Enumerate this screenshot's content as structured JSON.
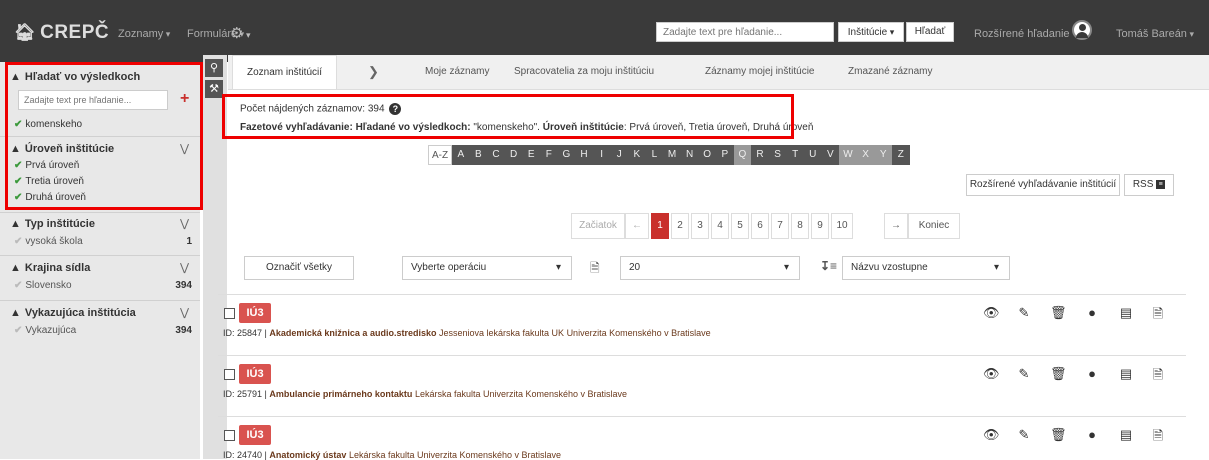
{
  "navbar": {
    "brand": "CREPČ",
    "menu_zoznamy": "Zoznamy",
    "menu_formulare": "Formuláre",
    "search_placeholder": "Zadajte text pre hľadanie...",
    "institution_select": "Inštitúcie",
    "search_button": "Hľadať",
    "advanced_search": "Rozšírené hľadanie",
    "user_name": "Tomáš Bareán"
  },
  "sidebar": {
    "search_results": {
      "title": "Hľadať vo výsledkoch",
      "placeholder": "Zadajte text pre hľadanie...",
      "active_term": "komenskeho"
    },
    "sections": [
      {
        "title": "Úroveň inštitúcie",
        "items": [
          {
            "label": "Prvá úroveň"
          },
          {
            "label": "Tretia úroveň"
          },
          {
            "label": "Druhá úroveň"
          }
        ]
      },
      {
        "title": "Typ inštitúcie",
        "items": [
          {
            "label": "vysoká škola",
            "count": "1"
          }
        ]
      },
      {
        "title": "Krajina sídla",
        "items": [
          {
            "label": "Slovensko",
            "count": "394"
          }
        ]
      },
      {
        "title": "Vykazujúca inštitúcia",
        "items": [
          {
            "label": "Vykazujúca",
            "count": "394"
          }
        ]
      }
    ]
  },
  "tabs": [
    "Zoznam inštitúcií",
    "Moje záznamy",
    "Spracovatelia za moju inštitúciu",
    "Záznamy mojej inštitúcie",
    "Zmazané záznamy"
  ],
  "info": {
    "count_label": "Počet nájdených záznamov: 394",
    "facet_label": "Fazetové vyhľadávanie:",
    "facet_search_label": "Hľadané vo výsledkoch:",
    "facet_search_value": "\"komenskeho\".",
    "facet_level_label": "Úroveň inštitúcie",
    "facet_level_value": ": Prvá úroveň, Tretia úroveň, Druhá úroveň"
  },
  "alphabet": [
    "A-Z",
    "A",
    "B",
    "C",
    "D",
    "E",
    "F",
    "G",
    "H",
    "I",
    "J",
    "K",
    "L",
    "M",
    "N",
    "O",
    "P",
    "Q",
    "R",
    "S",
    "T",
    "U",
    "V",
    "W",
    "X",
    "Y",
    "Z"
  ],
  "buttons": {
    "advanced_institutions": "Rozšírené vyhľadávanie inštitúcií",
    "rss": "RSS",
    "select_all": "Označiť všetky"
  },
  "pager": {
    "start": "Začiatok",
    "prev": "←",
    "pages": [
      "1",
      "2",
      "3",
      "4",
      "5",
      "6",
      "7",
      "8",
      "9",
      "10"
    ],
    "next": "→",
    "end": "Koniec"
  },
  "controls": {
    "operation": "Vyberte operáciu",
    "page_size": "20",
    "sort": "Názvu vzostupne"
  },
  "records": [
    {
      "badge": "IÚ3",
      "id": "ID: 25847 |",
      "title": "Akademická knižnica a audio.stredisko",
      "links": [
        "Jesseniova lekárska fakulta UK",
        "Univerzita Komenského v Bratislave"
      ]
    },
    {
      "badge": "IÚ3",
      "id": "ID: 25791 |",
      "title": "Ambulancie primárneho kontaktu",
      "links": [
        "Lekárska fakulta",
        "Univerzita Komenského v Bratislave"
      ]
    },
    {
      "badge": "IÚ3",
      "id": "ID: 24740 |",
      "title": "Anatomický ústav",
      "links": [
        "Lekárska fakulta",
        "Univerzita Komenského v Bratislave"
      ]
    }
  ]
}
